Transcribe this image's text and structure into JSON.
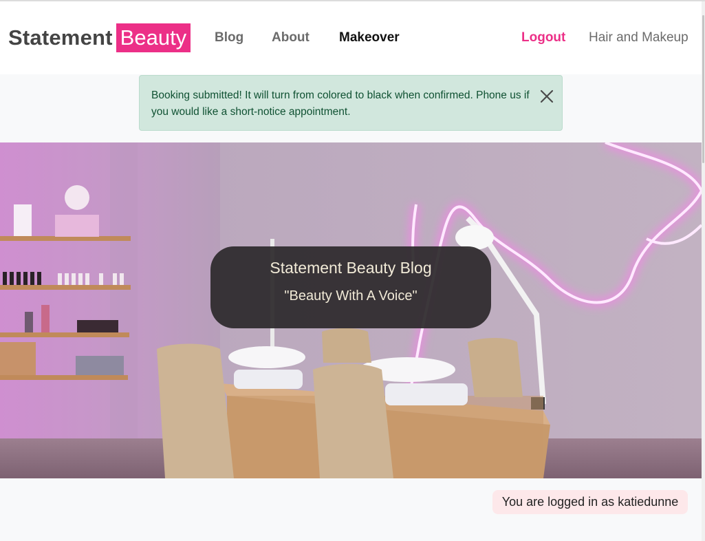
{
  "navbar": {
    "brand_primary": "Statement",
    "brand_highlight": "Beauty",
    "links": [
      "Blog",
      "About",
      "Makeover"
    ],
    "logout": "Logout",
    "category": "Hair and Makeup"
  },
  "alert": {
    "message": "Booking submitted! It will turn from colored to black when confirmed. Phone us if you would like a short-notice appointment.",
    "close_icon": "close-icon"
  },
  "hero": {
    "title": "Statement Beauty Blog",
    "tagline": "\"Beauty With A Voice\""
  },
  "status": {
    "logged_in_text": "You are logged in as katiedunne"
  },
  "colors": {
    "brand_pink": "#ec2f87",
    "alert_bg": "#d1e7dd",
    "alert_text": "#0f5132",
    "status_bg": "#fde8ea"
  }
}
